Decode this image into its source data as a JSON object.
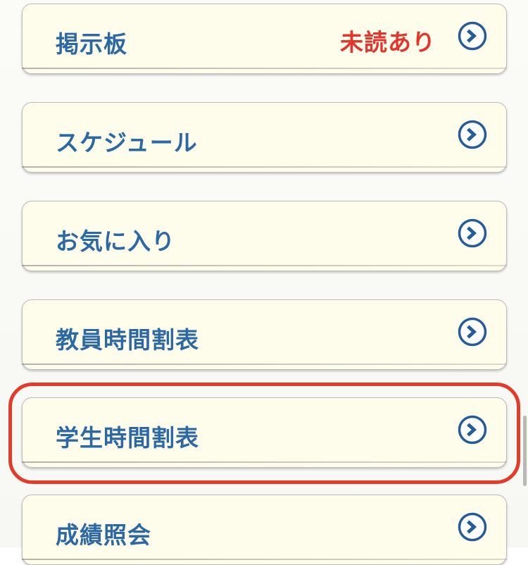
{
  "menu": {
    "items": [
      {
        "label": "掲示板",
        "badge": "未読あり"
      },
      {
        "label": "スケジュール"
      },
      {
        "label": "お気に入り"
      },
      {
        "label": "教員時間割表"
      },
      {
        "label": "学生時間割表"
      },
      {
        "label": "成績照会"
      }
    ]
  },
  "colors": {
    "label": "#2c68a4",
    "badge": "#e5342c",
    "item_background": "#fefdec",
    "highlight": "#e33a2a"
  },
  "icons": {
    "arrow": "chevron-right-circle-icon"
  },
  "highlighted_item": "学生時間割表"
}
